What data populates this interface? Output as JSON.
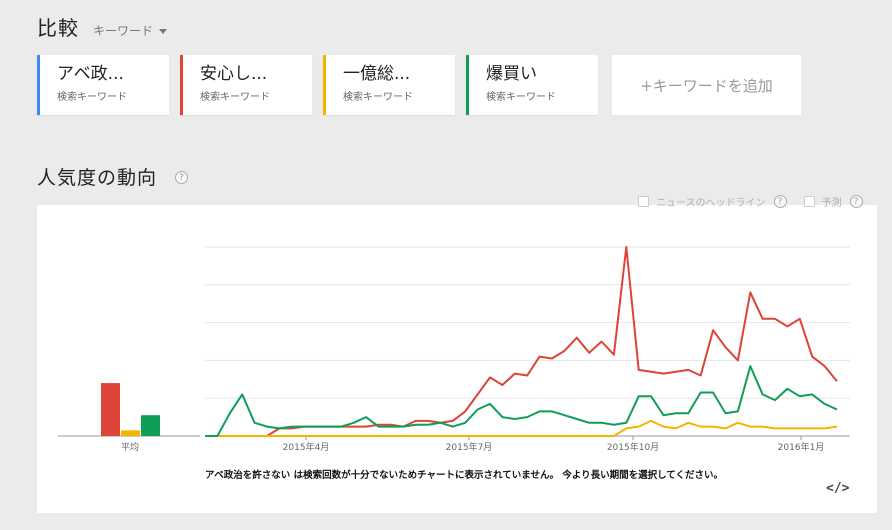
{
  "header": {
    "title": "比較",
    "mode_label": "キーワード"
  },
  "cards": [
    {
      "term": "アベ政...",
      "subtitle": "検索キーワード",
      "color": "#4285f4"
    },
    {
      "term": "安心し...",
      "subtitle": "検索キーワード",
      "color": "#db4437"
    },
    {
      "term": "一億総...",
      "subtitle": "検索キーワード",
      "color": "#f4b400"
    },
    {
      "term": "爆買い",
      "subtitle": "検索キーワード",
      "color": "#0f9d58"
    }
  ],
  "add_keyword_label": "+キーワードを追加",
  "section": {
    "title": "人気度の動向",
    "help": "?"
  },
  "options": {
    "news_label": "ニュースのヘッドライン",
    "forecast_label": "予測"
  },
  "notice": "アベ政治を許さない は検索回数が十分でないためチャートに表示されていません。 今より長い期間を選択してください。",
  "embed_label": "</>",
  "chart_data": {
    "type": "line",
    "ylim": [
      0,
      100
    ],
    "grid": true,
    "x_tick_labels": [
      "2015年4月",
      "2015年7月",
      "2015年10月",
      "2016年1月"
    ],
    "average": {
      "label": "平均",
      "type": "bar",
      "values": [
        {
          "name": "安心し...",
          "value": 28,
          "color": "#db4437"
        },
        {
          "name": "一億総...",
          "value": 3,
          "color": "#f4b400"
        },
        {
          "name": "爆買い",
          "value": 11,
          "color": "#0f9d58"
        }
      ]
    },
    "series": [
      {
        "name": "安心し...",
        "color": "#db4437",
        "values": [
          0,
          0,
          0,
          0,
          0,
          0,
          4,
          4,
          5,
          5,
          5,
          5,
          5,
          5,
          6,
          6,
          5,
          8,
          8,
          7,
          8,
          13,
          22,
          31,
          27,
          33,
          32,
          42,
          41,
          45,
          52,
          44,
          50,
          43,
          100,
          35,
          34,
          33,
          34,
          35,
          32,
          56,
          47,
          40,
          76,
          62,
          62,
          58,
          62,
          42,
          37,
          29
        ]
      },
      {
        "name": "一億総...",
        "color": "#f4b400",
        "values": [
          0,
          0,
          0,
          0,
          0,
          0,
          0,
          0,
          0,
          0,
          0,
          0,
          0,
          0,
          0,
          0,
          0,
          0,
          0,
          0,
          0,
          0,
          0,
          0,
          0,
          0,
          0,
          0,
          0,
          0,
          0,
          0,
          0,
          0,
          4,
          5,
          8,
          5,
          4,
          7,
          5,
          5,
          4,
          7,
          5,
          5,
          4,
          4,
          4,
          4,
          4,
          5
        ]
      },
      {
        "name": "爆買い",
        "color": "#0f9d58",
        "values": [
          0,
          0,
          12,
          22,
          7,
          5,
          4,
          5,
          5,
          5,
          5,
          5,
          7,
          10,
          5,
          5,
          5,
          6,
          6,
          7,
          5,
          7,
          14,
          17,
          10,
          9,
          10,
          13,
          13,
          11,
          9,
          7,
          7,
          6,
          7,
          21,
          21,
          11,
          12,
          12,
          23,
          23,
          12,
          13,
          37,
          22,
          19,
          25,
          21,
          22,
          17,
          14
        ]
      }
    ]
  }
}
